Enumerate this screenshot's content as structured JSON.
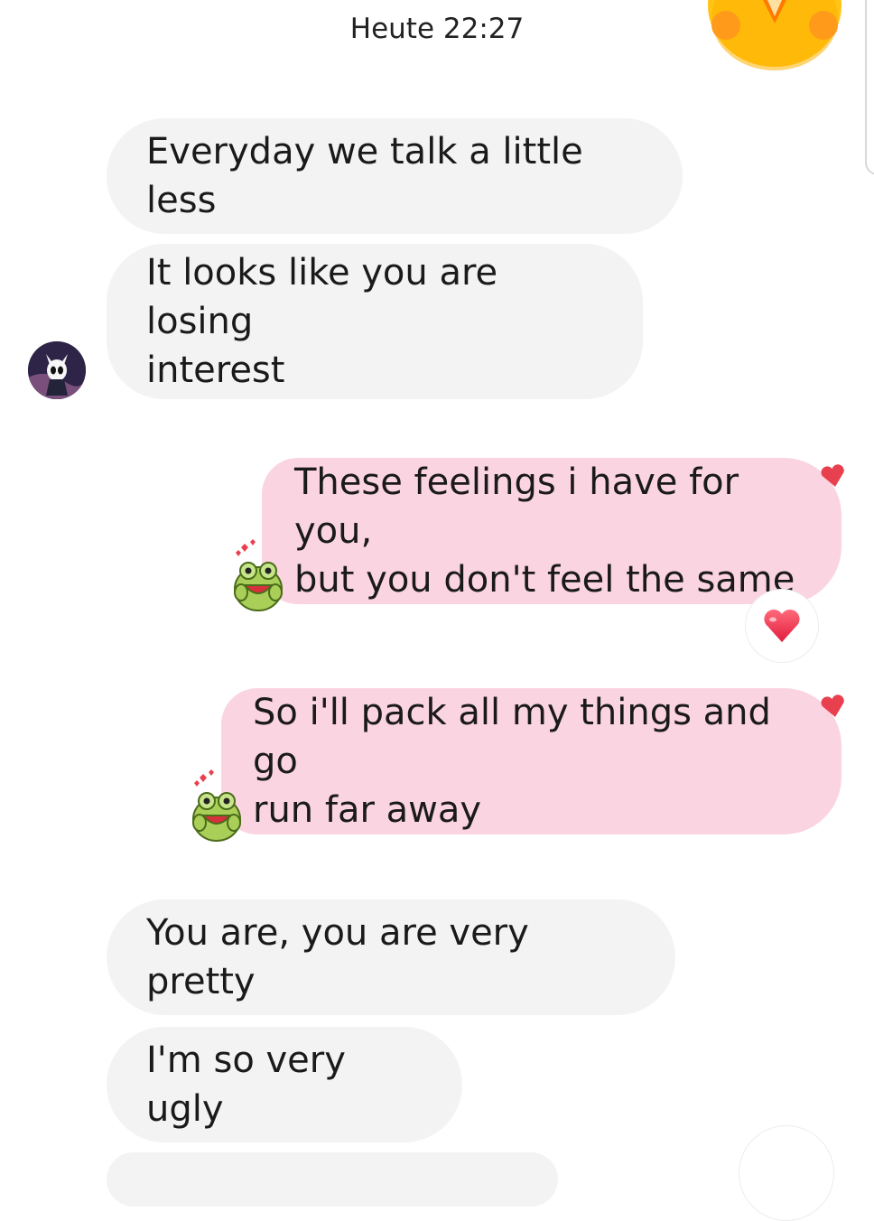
{
  "header": {
    "timestamp": "Heute 22:27"
  },
  "messages": [
    {
      "sender": "other",
      "text": "Everyday we talk a little less"
    },
    {
      "sender": "other",
      "text": "It looks like you are losing\ninterest"
    },
    {
      "sender": "me",
      "text": "These feelings i have for you,\nbut you don't feel the same"
    },
    {
      "sender": "me",
      "text": "So i'll pack all my things and go\nrun far away"
    },
    {
      "sender": "other",
      "text": "You are, you are very pretty"
    },
    {
      "sender": "other",
      "text": "I'm so very ugly"
    }
  ],
  "icons": {
    "avatar": "hollow-knight-avatar",
    "seen_sticker": "frog-sticker",
    "liked_mark": "heart-icon",
    "reaction": "red-heart-emoji",
    "corner_emoji": "smiling-face-emoji"
  },
  "colors": {
    "incoming_bubble": "#f3f3f3",
    "outgoing_bubble": "#fbd4e1",
    "heart": "#e8404f"
  }
}
